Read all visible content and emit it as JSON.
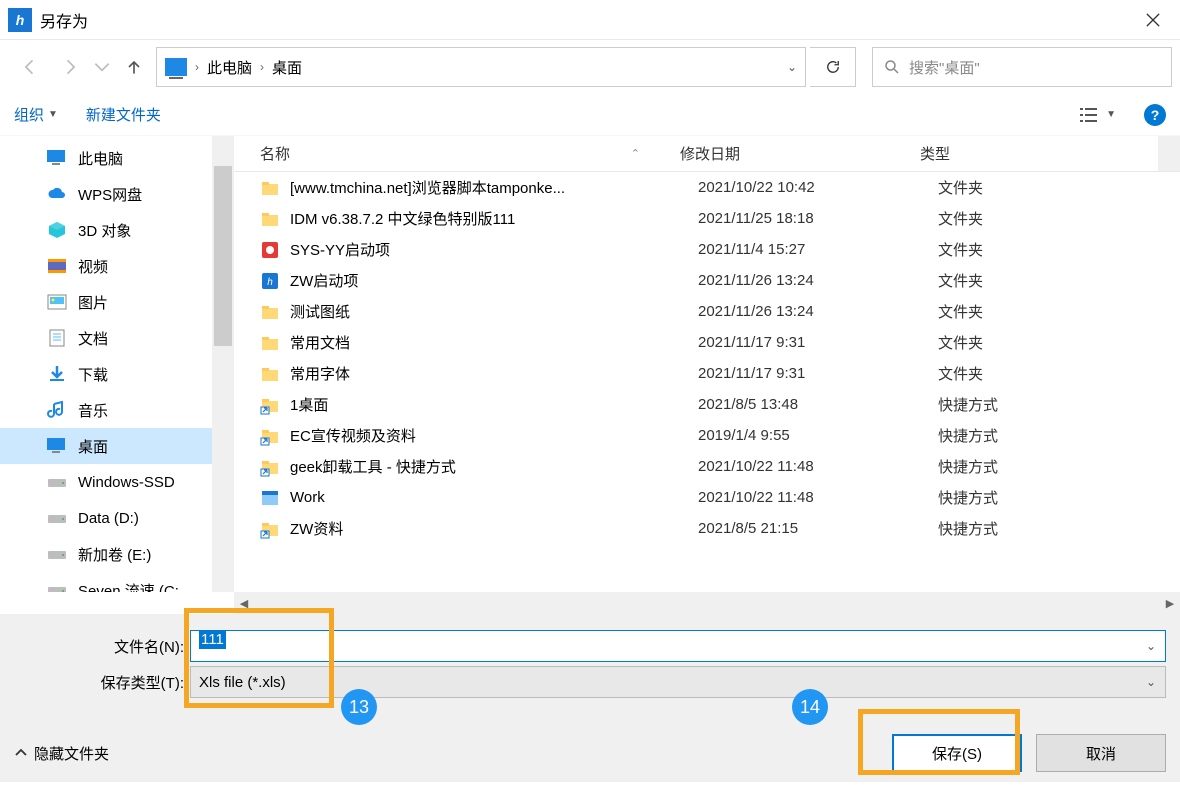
{
  "title": "另存为",
  "breadcrumb": {
    "root": "此电脑",
    "leaf": "桌面"
  },
  "search": {
    "placeholder": "搜索\"桌面\""
  },
  "toolbar": {
    "organize": "组织",
    "newFolder": "新建文件夹"
  },
  "tree": [
    {
      "label": "此电脑",
      "icon": "monitor"
    },
    {
      "label": "WPS网盘",
      "icon": "cloud"
    },
    {
      "label": "3D 对象",
      "icon": "cube"
    },
    {
      "label": "视频",
      "icon": "video"
    },
    {
      "label": "图片",
      "icon": "image"
    },
    {
      "label": "文档",
      "icon": "doc"
    },
    {
      "label": "下载",
      "icon": "download"
    },
    {
      "label": "音乐",
      "icon": "music"
    },
    {
      "label": "桌面",
      "icon": "desktop",
      "selected": true
    },
    {
      "label": "Windows-SSD",
      "icon": "drive"
    },
    {
      "label": "Data (D:)",
      "icon": "drive"
    },
    {
      "label": "新加卷 (E:)",
      "icon": "drive"
    },
    {
      "label": "Seven 流速 (C:",
      "icon": "drive"
    }
  ],
  "cols": {
    "name": "名称",
    "date": "修改日期",
    "type": "类型"
  },
  "files": [
    {
      "icon": "folder",
      "name": "[www.tmchina.net]浏览器脚本tamponke...",
      "date": "2021/10/22 10:42",
      "type": "文件夹"
    },
    {
      "icon": "folder",
      "name": "IDM v6.38.7.2  中文绿色特别版111",
      "date": "2021/11/25 18:18",
      "type": "文件夹"
    },
    {
      "icon": "app-red",
      "name": "SYS-YY启动项",
      "date": "2021/11/4 15:27",
      "type": "文件夹"
    },
    {
      "icon": "app-blue",
      "name": "ZW启动项",
      "date": "2021/11/26 13:24",
      "type": "文件夹"
    },
    {
      "icon": "folder",
      "name": "测试图纸",
      "date": "2021/11/26 13:24",
      "type": "文件夹"
    },
    {
      "icon": "folder",
      "name": "常用文档",
      "date": "2021/11/17 9:31",
      "type": "文件夹"
    },
    {
      "icon": "folder",
      "name": "常用字体",
      "date": "2021/11/17 9:31",
      "type": "文件夹"
    },
    {
      "icon": "shortcut",
      "name": "1桌面",
      "date": "2021/8/5 13:48",
      "type": "快捷方式"
    },
    {
      "icon": "shortcut",
      "name": "EC宣传视频及资料",
      "date": "2019/1/4 9:55",
      "type": "快捷方式"
    },
    {
      "icon": "shortcut",
      "name": "geek卸载工具 - 快捷方式",
      "date": "2021/10/22 11:48",
      "type": "快捷方式"
    },
    {
      "icon": "exe",
      "name": "Work",
      "date": "2021/10/22 11:48",
      "type": "快捷方式"
    },
    {
      "icon": "shortcut",
      "name": "ZW资料",
      "date": "2021/8/5 21:15",
      "type": "快捷方式"
    }
  ],
  "form": {
    "filenameLabel": "文件名(N):",
    "filetypeLabel": "保存类型(T):",
    "filenameValue": "111",
    "filetypeValue": "Xls file (*.xls)"
  },
  "footer": {
    "hideFolders": "隐藏文件夹",
    "save": "保存(S)",
    "cancel": "取消"
  },
  "markers": {
    "a": "13",
    "b": "14"
  }
}
